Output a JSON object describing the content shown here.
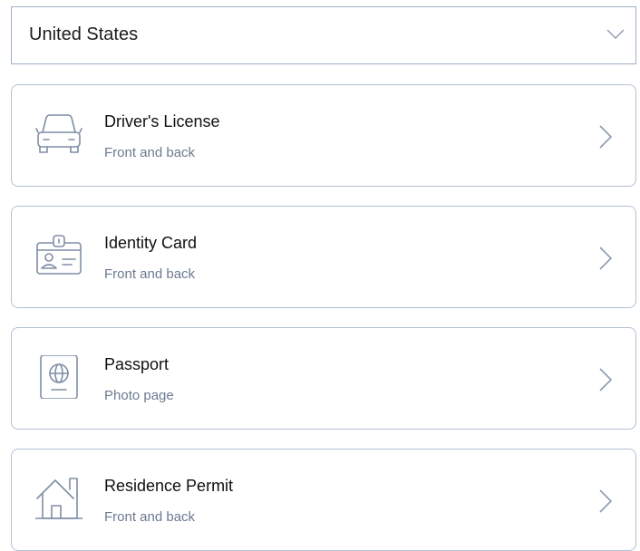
{
  "country_select": {
    "value": "United States",
    "icon": "chevron-down-icon"
  },
  "documents": [
    {
      "title": "Driver's License",
      "subtitle": "Front and back",
      "icon": "car-icon"
    },
    {
      "title": "Identity Card",
      "subtitle": "Front and back",
      "icon": "id-card-icon"
    },
    {
      "title": "Passport",
      "subtitle": "Photo page",
      "icon": "passport-icon"
    },
    {
      "title": "Residence Permit",
      "subtitle": "Front and back",
      "icon": "house-icon"
    }
  ],
  "colors": {
    "border": "#b3c0d3",
    "icon_stroke": "#7f8ea6",
    "subtitle": "#6b7a90"
  }
}
